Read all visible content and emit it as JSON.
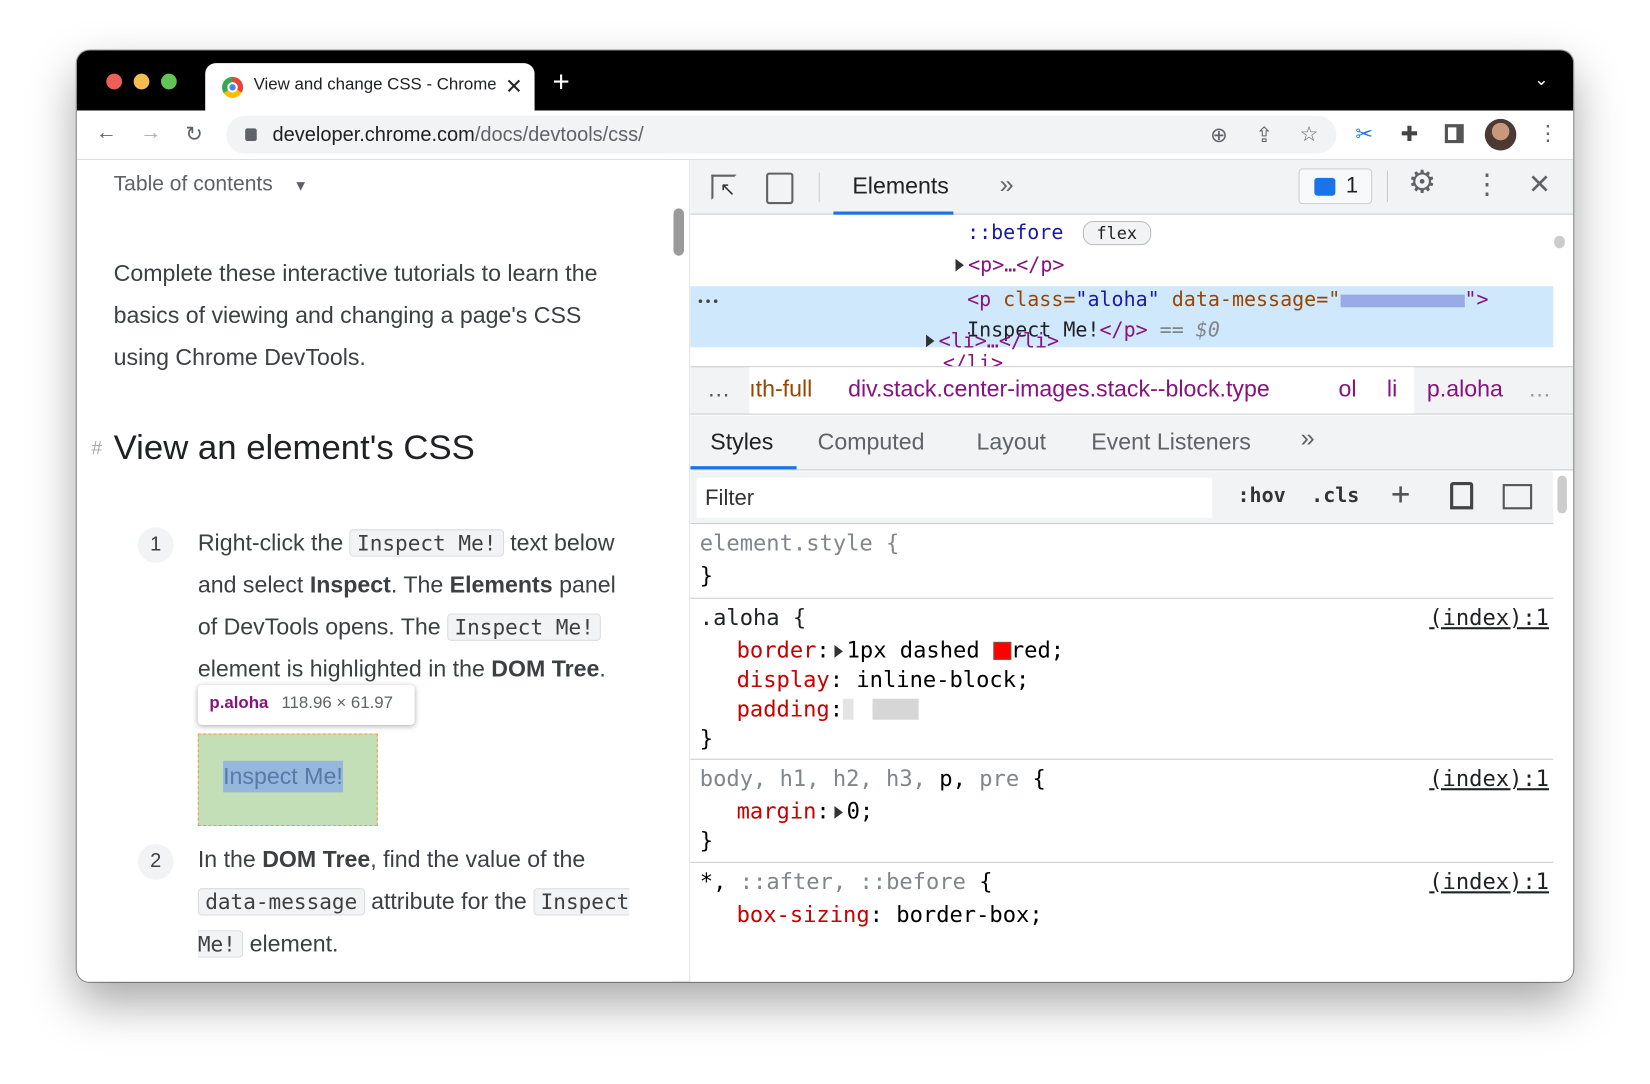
{
  "browser": {
    "tab_title": "View and change CSS - Chrome",
    "url_host": "developer.chrome.com",
    "url_path": "/docs/devtools/css/",
    "icons": [
      "chrome-logo",
      "close-icon",
      "new-tab-icon",
      "back-icon",
      "forward-icon",
      "reload-icon",
      "lock-icon",
      "zoom-icon",
      "share-icon",
      "star-icon",
      "scissors-icon",
      "extensions-icon",
      "side-panel-icon",
      "avatar",
      "more-icon",
      "tab-list-chevron-icon"
    ]
  },
  "page": {
    "toc_label": "Table of contents",
    "intro": "Complete these interactive tutorials to learn the basics of viewing and changing a page's CSS using Chrome DevTools.",
    "heading_anchor": "#",
    "heading": "View an element's CSS",
    "step1": {
      "num": "1",
      "t1": "Right-click the",
      "code1": "Inspect Me!",
      "t2": "text below and select",
      "b1": "Inspect",
      "t3": ". The",
      "b2": "Elements",
      "t4": "panel of DevTools opens. The",
      "code2": "Inspect Me!",
      "t5": "element is highlighted in the",
      "b3": "DOM Tree",
      "t6": "."
    },
    "tooltip": {
      "selector": "p.aloha",
      "size": "118.96 × 61.97"
    },
    "inspect_box": "Inspect Me!",
    "step2": {
      "num": "2",
      "t1": "In the",
      "b1": "DOM Tree",
      "t2": ", find the value of the",
      "code1": "data-message",
      "t3": "attribute for the",
      "code2": "Inspect Me!",
      "t4": "element."
    }
  },
  "devtools": {
    "main_tab": "Elements",
    "more_tabs": "»",
    "issues_count": "1",
    "dom": {
      "before": "::before",
      "flex_badge": "flex",
      "p_collapsed": "<p>…</p>",
      "sel_open": "<p ",
      "sel_attr1": "class",
      "sel_val1": "\"aloha\"",
      "sel_attr2": "data-message",
      "sel_eq": "=\"",
      "sel_close": "\">",
      "sel_text": "Inspect Me!",
      "sel_end": "</p>",
      "sel_marker": " == ",
      "sel_var": "$0",
      "li_close": "</li>",
      "li_collapsed": "<li>…</li>",
      "row_dots": "•••"
    },
    "breadcrumbs": [
      "…",
      "ıth-full",
      "div.stack.center-images.stack--block.type",
      "ol",
      "li",
      "p.aloha",
      "…"
    ],
    "style_tabs": [
      "Styles",
      "Computed",
      "Layout",
      "Event Listeners",
      "»"
    ],
    "filter_placeholder": "Filter",
    "hov": ":hov",
    "cls": ".cls",
    "rules": {
      "element_style": "element.style {",
      "close": "}",
      "aloha_sel": ".aloha {",
      "source": "(index):1",
      "border_prop": "border",
      "border_val1": "1px dashed",
      "border_color": "#ff0000",
      "border_val2": "red;",
      "display_prop": "display",
      "display_val": "inline-block;",
      "padding_prop": "padding",
      "body_sel_grey": "body, h1, h2, h3,",
      "body_sel_p": "p,",
      "body_sel_pre": "pre",
      "brace": "{",
      "margin_prop": "margin",
      "margin_val": "0;",
      "star_sel": "*,",
      "star_rest": "::after, ::before",
      "boxsizing_prop": "box-sizing",
      "boxsizing_val": "border-box;"
    }
  }
}
